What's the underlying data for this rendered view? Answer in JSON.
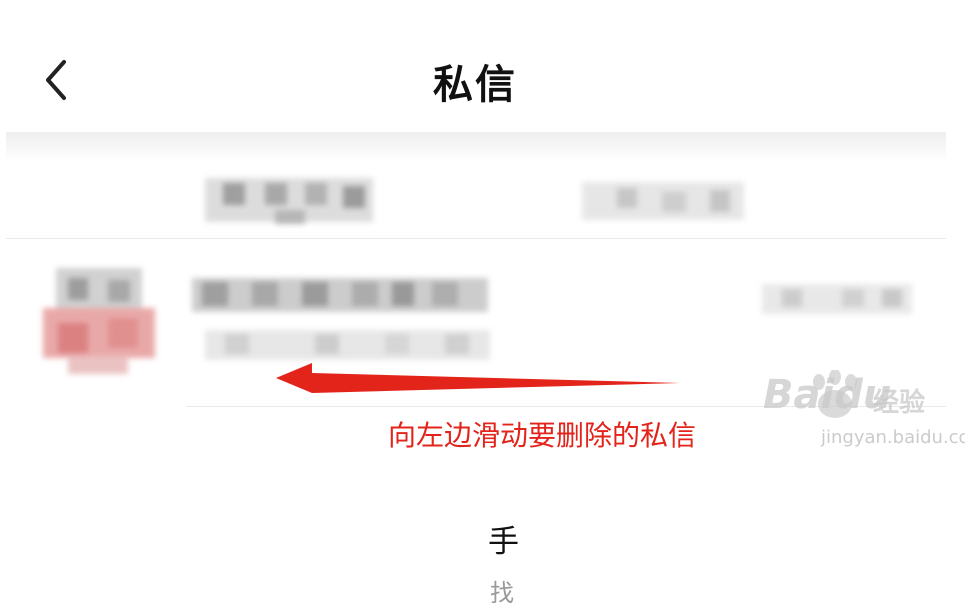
{
  "header": {
    "title": "私信",
    "back_icon": "chevron-left-icon"
  },
  "conversation": {
    "name_suffix": "手",
    "preview_suffix": "找"
  },
  "annotation": {
    "hint_text": "向左边滑动要删除的私信",
    "arrow_color": "#e3241b"
  },
  "watermark": {
    "brand": "Baidu",
    "brand_cn": "经验",
    "url": "jingyan.baidu.com"
  }
}
